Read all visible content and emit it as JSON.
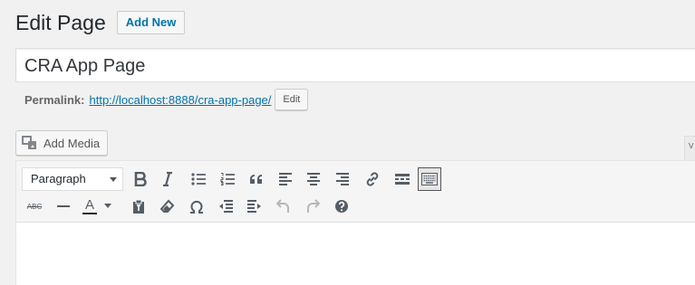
{
  "heading": {
    "title": "Edit Page",
    "add_new_label": "Add New"
  },
  "post_title": {
    "value": "CRA App Page"
  },
  "permalink": {
    "label": "Permalink:",
    "url": "http://localhost:8888/cra-app-page/",
    "edit_label": "Edit"
  },
  "media": {
    "add_media_label": "Add Media"
  },
  "editor_tab": {
    "label": "V"
  },
  "toolbar": {
    "format_select": {
      "selected": "Paragraph"
    },
    "row1_icons": [
      "bold-icon",
      "italic-icon",
      "bulleted-list-icon",
      "numbered-list-icon",
      "blockquote-icon",
      "align-left-icon",
      "align-center-icon",
      "align-right-icon",
      "link-icon",
      "read-more-icon",
      "toolbar-toggle-icon"
    ],
    "row2_icons": [
      "strikethrough-icon",
      "horizontal-line-icon",
      "text-color-icon",
      "paste-as-text-icon",
      "clear-formatting-icon",
      "special-character-icon",
      "outdent-icon",
      "indent-icon",
      "undo-icon",
      "redo-icon",
      "help-icon"
    ],
    "strike_label": "ABC",
    "text_color_label": "A",
    "colors": {
      "text_color_bar": "#23282d",
      "active_toggle_border": "#555555"
    }
  }
}
